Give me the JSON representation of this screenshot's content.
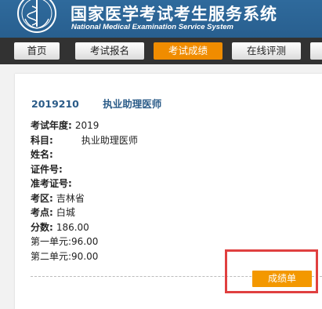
{
  "header": {
    "title": "国家医学考试考生服务系统",
    "subtitle": "National Medical Examination Service System",
    "logo_icon": "medical-emblem-icon"
  },
  "nav": {
    "items": [
      {
        "label": "首页",
        "active": false
      },
      {
        "label": "考试报名",
        "active": false
      },
      {
        "label": "考试成绩",
        "active": true
      },
      {
        "label": "在线评测",
        "active": false
      }
    ]
  },
  "exam": {
    "code": "2019210",
    "name": "执业助理医师"
  },
  "details": {
    "year_label": "考试年度:",
    "year": "2019",
    "subject_label": "科目:",
    "subject": "执业助理医师",
    "name_label": "姓名:",
    "name": "",
    "id_label": "证件号:",
    "id": "",
    "ticket_label": "准考证号:",
    "ticket": "",
    "region_label": "考区:",
    "region": "吉林省",
    "site_label": "考点:",
    "site": "白城",
    "score_label": "分数:",
    "score": "186.00",
    "unit1_label": "第一单元:",
    "unit1": "96.00",
    "unit2_label": "第二单元:",
    "unit2": "90.00"
  },
  "actions": {
    "score_sheet_label": "成绩单"
  },
  "colors": {
    "header_bg": "#2d6596",
    "nav_bg": "#323232",
    "accent": "#f39800",
    "highlight": "#e04040",
    "exam_title": "#2a5b88"
  }
}
